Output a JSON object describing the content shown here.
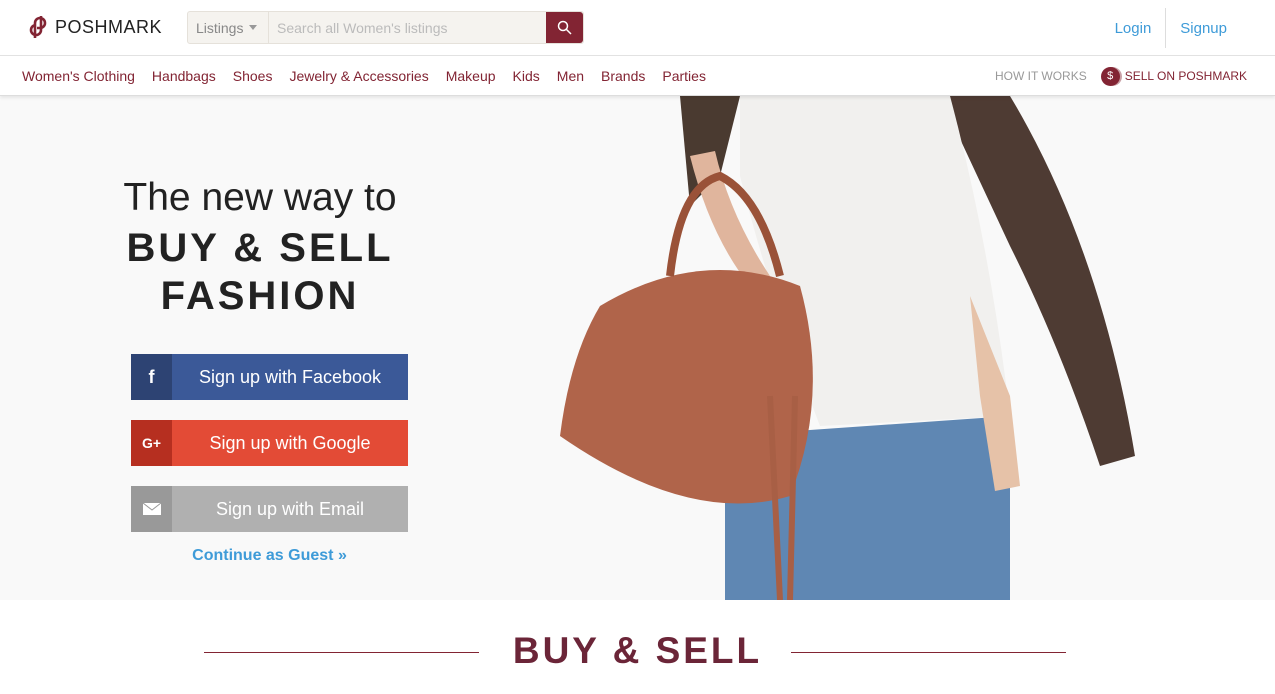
{
  "header": {
    "logo": "POSHMARK",
    "search": {
      "category": "Listings",
      "placeholder": "Search all Women's listings"
    },
    "login": "Login",
    "signup": "Signup"
  },
  "nav": {
    "items": [
      "Women's Clothing",
      "Handbags",
      "Shoes",
      "Jewelry & Accessories",
      "Makeup",
      "Kids",
      "Men",
      "Brands",
      "Parties"
    ],
    "how": "HOW IT WORKS",
    "sell": "SELL ON POSHMARK",
    "coin": "$"
  },
  "hero": {
    "line1": "The new way to",
    "line2": "BUY & SELL",
    "line3": "FASHION",
    "facebook": "Sign up with Facebook",
    "google": "Sign up with Google",
    "email": "Sign up with Email",
    "guest": "Continue as Guest »",
    "fb_icon": "f",
    "g_icon": "G+"
  },
  "section": {
    "title": "BUY & SELL"
  },
  "colors": {
    "brand": "#822433",
    "link": "#3e9bd8",
    "facebook": "#3b5998",
    "google": "#e34b36",
    "email": "#b0b0b0"
  }
}
